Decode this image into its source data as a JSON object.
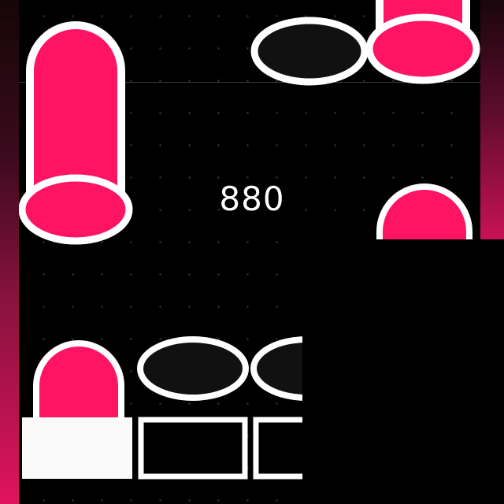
{
  "game": {
    "score": "880"
  },
  "colors": {
    "background": "#000000",
    "pink": "#ff1464",
    "white": "#ffffff",
    "dark_hole": "#111111"
  },
  "elements": {
    "pink_capsule_top_left": {
      "type": "long-note"
    },
    "pink_capsule_top_right": {
      "type": "long-note"
    },
    "pink_capsule_right_mid": {
      "type": "long-note"
    },
    "pink_capsule_bottom_left": {
      "type": "long-note"
    },
    "black_tap_top": {
      "type": "tap-note"
    },
    "black_tap_bottom_1": {
      "type": "tap-note"
    },
    "black_tap_bottom_2": {
      "type": "tap-note"
    },
    "hit_pad_1": {
      "state": "pressed"
    },
    "hit_pad_2": {
      "state": "idle"
    },
    "hit_pad_3": {
      "state": "idle"
    }
  }
}
